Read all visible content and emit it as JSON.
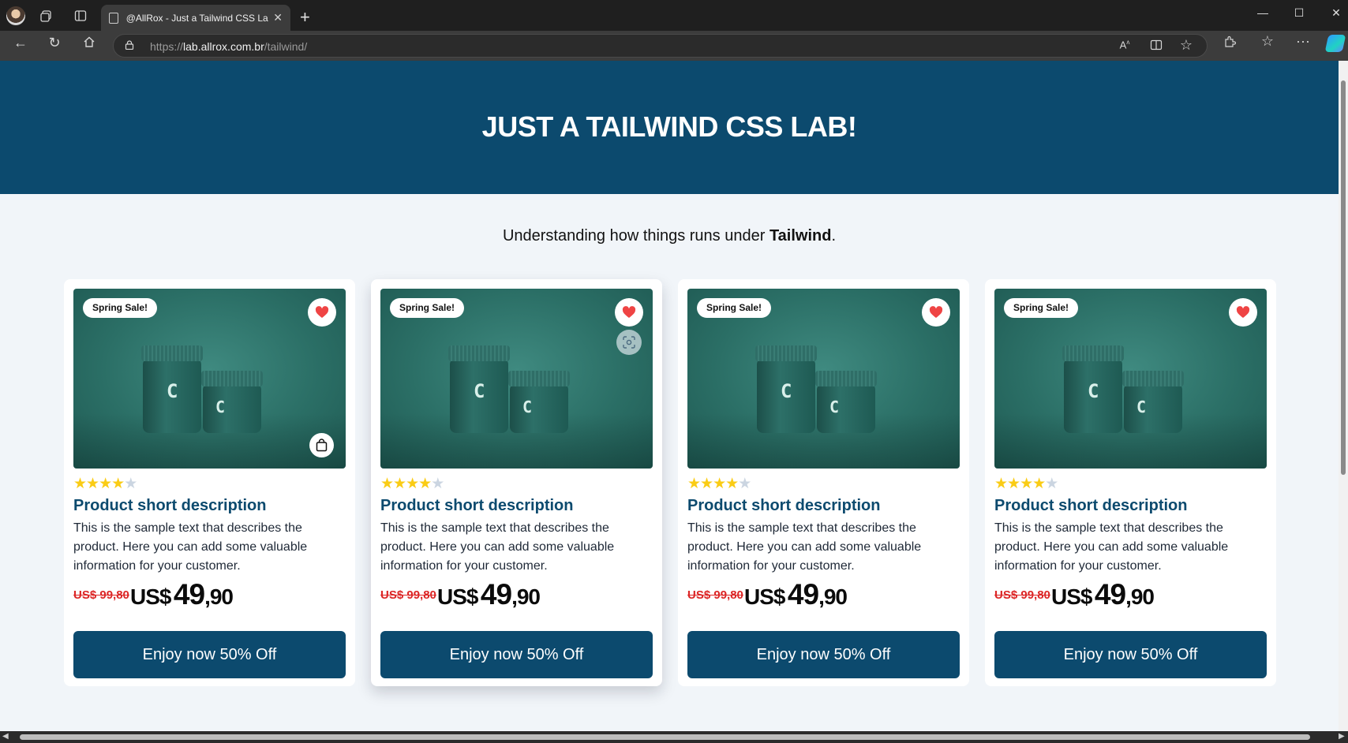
{
  "browser": {
    "tab_title": "@AllRox - Just a Tailwind CSS Lab!",
    "url_prefix": "https://",
    "url_host": "lab.allrox.com.br",
    "url_path": "/tailwind/"
  },
  "page": {
    "hero_title": "JUST A TAILWIND CSS LAB!",
    "subtitle_text": "Understanding how things runs under ",
    "subtitle_bold": "Tailwind",
    "subtitle_end": "."
  },
  "colors": {
    "hero": "#0c4a6e",
    "accent": "#0c4a6e",
    "sale_price": "#dc2626",
    "star": "#facc15",
    "heart": "#ef4444"
  },
  "cards": [
    {
      "badge": "Spring Sale!",
      "rating": 4,
      "max_rating": 5,
      "title": "Product short description",
      "description": "This is the sample text that describes the product. Here you can add some valuable information for your customer.",
      "old_price": "US$ 99,80",
      "currency": "US$",
      "price_int": "49",
      "price_dec": ",90",
      "cta": "Enjoy now 50% Off",
      "icons": [
        "heart-icon",
        "shopping-bag-icon"
      ]
    },
    {
      "badge": "Spring Sale!",
      "rating": 4,
      "max_rating": 5,
      "title": "Product short description",
      "description": "This is the sample text that describes the product. Here you can add some valuable information for your customer.",
      "old_price": "US$ 99,80",
      "currency": "US$",
      "price_int": "49",
      "price_dec": ",90",
      "cta": "Enjoy now 50% Off",
      "icons": [
        "heart-icon",
        "visual-search-icon"
      ]
    },
    {
      "badge": "Spring Sale!",
      "rating": 4,
      "max_rating": 5,
      "title": "Product short description",
      "description": "This is the sample text that describes the product. Here you can add some valuable information for your customer.",
      "old_price": "US$ 99,80",
      "currency": "US$",
      "price_int": "49",
      "price_dec": ",90",
      "cta": "Enjoy now 50% Off",
      "icons": [
        "heart-icon"
      ]
    },
    {
      "badge": "Spring Sale!",
      "rating": 4,
      "max_rating": 5,
      "title": "Product short description",
      "description": "This is the sample text that describes the product. Here you can add some valuable information for your customer.",
      "old_price": "US$ 99,80",
      "currency": "US$",
      "price_int": "49",
      "price_dec": ",90",
      "cta": "Enjoy now 50% Off",
      "icons": [
        "heart-icon"
      ]
    }
  ]
}
